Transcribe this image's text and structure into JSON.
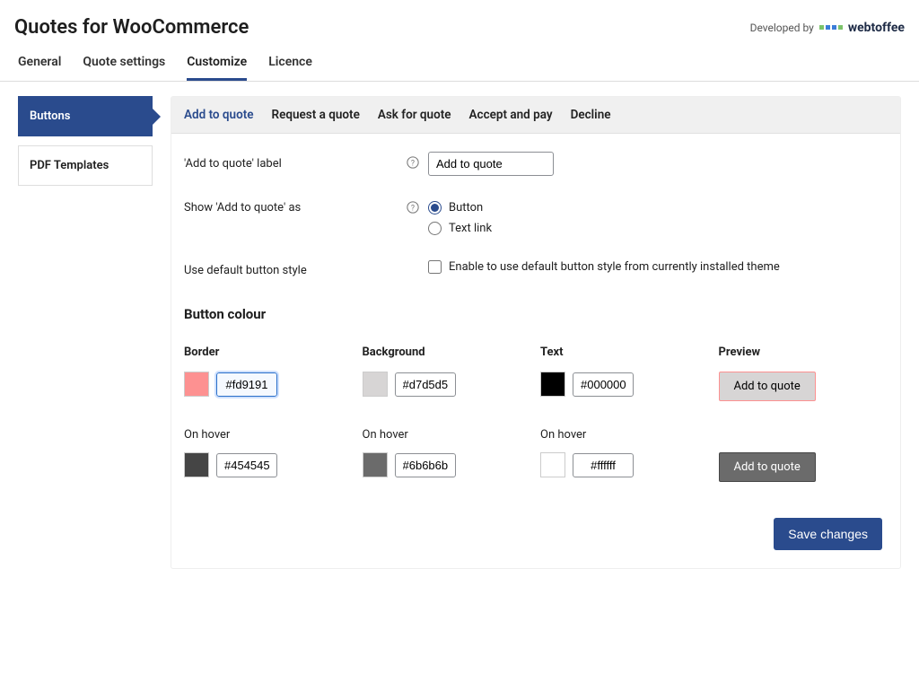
{
  "header": {
    "title": "Quotes for WooCommerce",
    "developed_by": "Developed by",
    "brand": "webtoffee"
  },
  "tabs": [
    "General",
    "Quote settings",
    "Customize",
    "Licence"
  ],
  "active_tab": "Customize",
  "sidebar": {
    "items": [
      "Buttons",
      "PDF Templates"
    ],
    "active": "Buttons"
  },
  "subtabs": [
    "Add to quote",
    "Request a quote",
    "Ask for quote",
    "Accept and pay",
    "Decline"
  ],
  "active_subtab": "Add to quote",
  "form": {
    "label_field_label": "'Add to quote' label",
    "label_field_value": "Add to quote",
    "show_as_label": "Show 'Add to quote' as",
    "radio_button": "Button",
    "radio_textlink": "Text link",
    "radio_selected": "Button",
    "default_style_label": "Use default button style",
    "default_style_desc": "Enable to use default button style from currently installed theme",
    "default_style_checked": false
  },
  "colors": {
    "section_title": "Button colour",
    "headers": {
      "border": "Border",
      "background": "Background",
      "text": "Text",
      "preview": "Preview"
    },
    "onhover_label": "On hover",
    "border": {
      "normal": "#fd9191",
      "hover": "#454545"
    },
    "background": {
      "normal": "#d7d5d5",
      "hover": "#6b6b6b"
    },
    "text": {
      "normal": "#000000",
      "hover": "#ffffff"
    },
    "preview_text": "Add to quote"
  },
  "save_label": "Save changes"
}
